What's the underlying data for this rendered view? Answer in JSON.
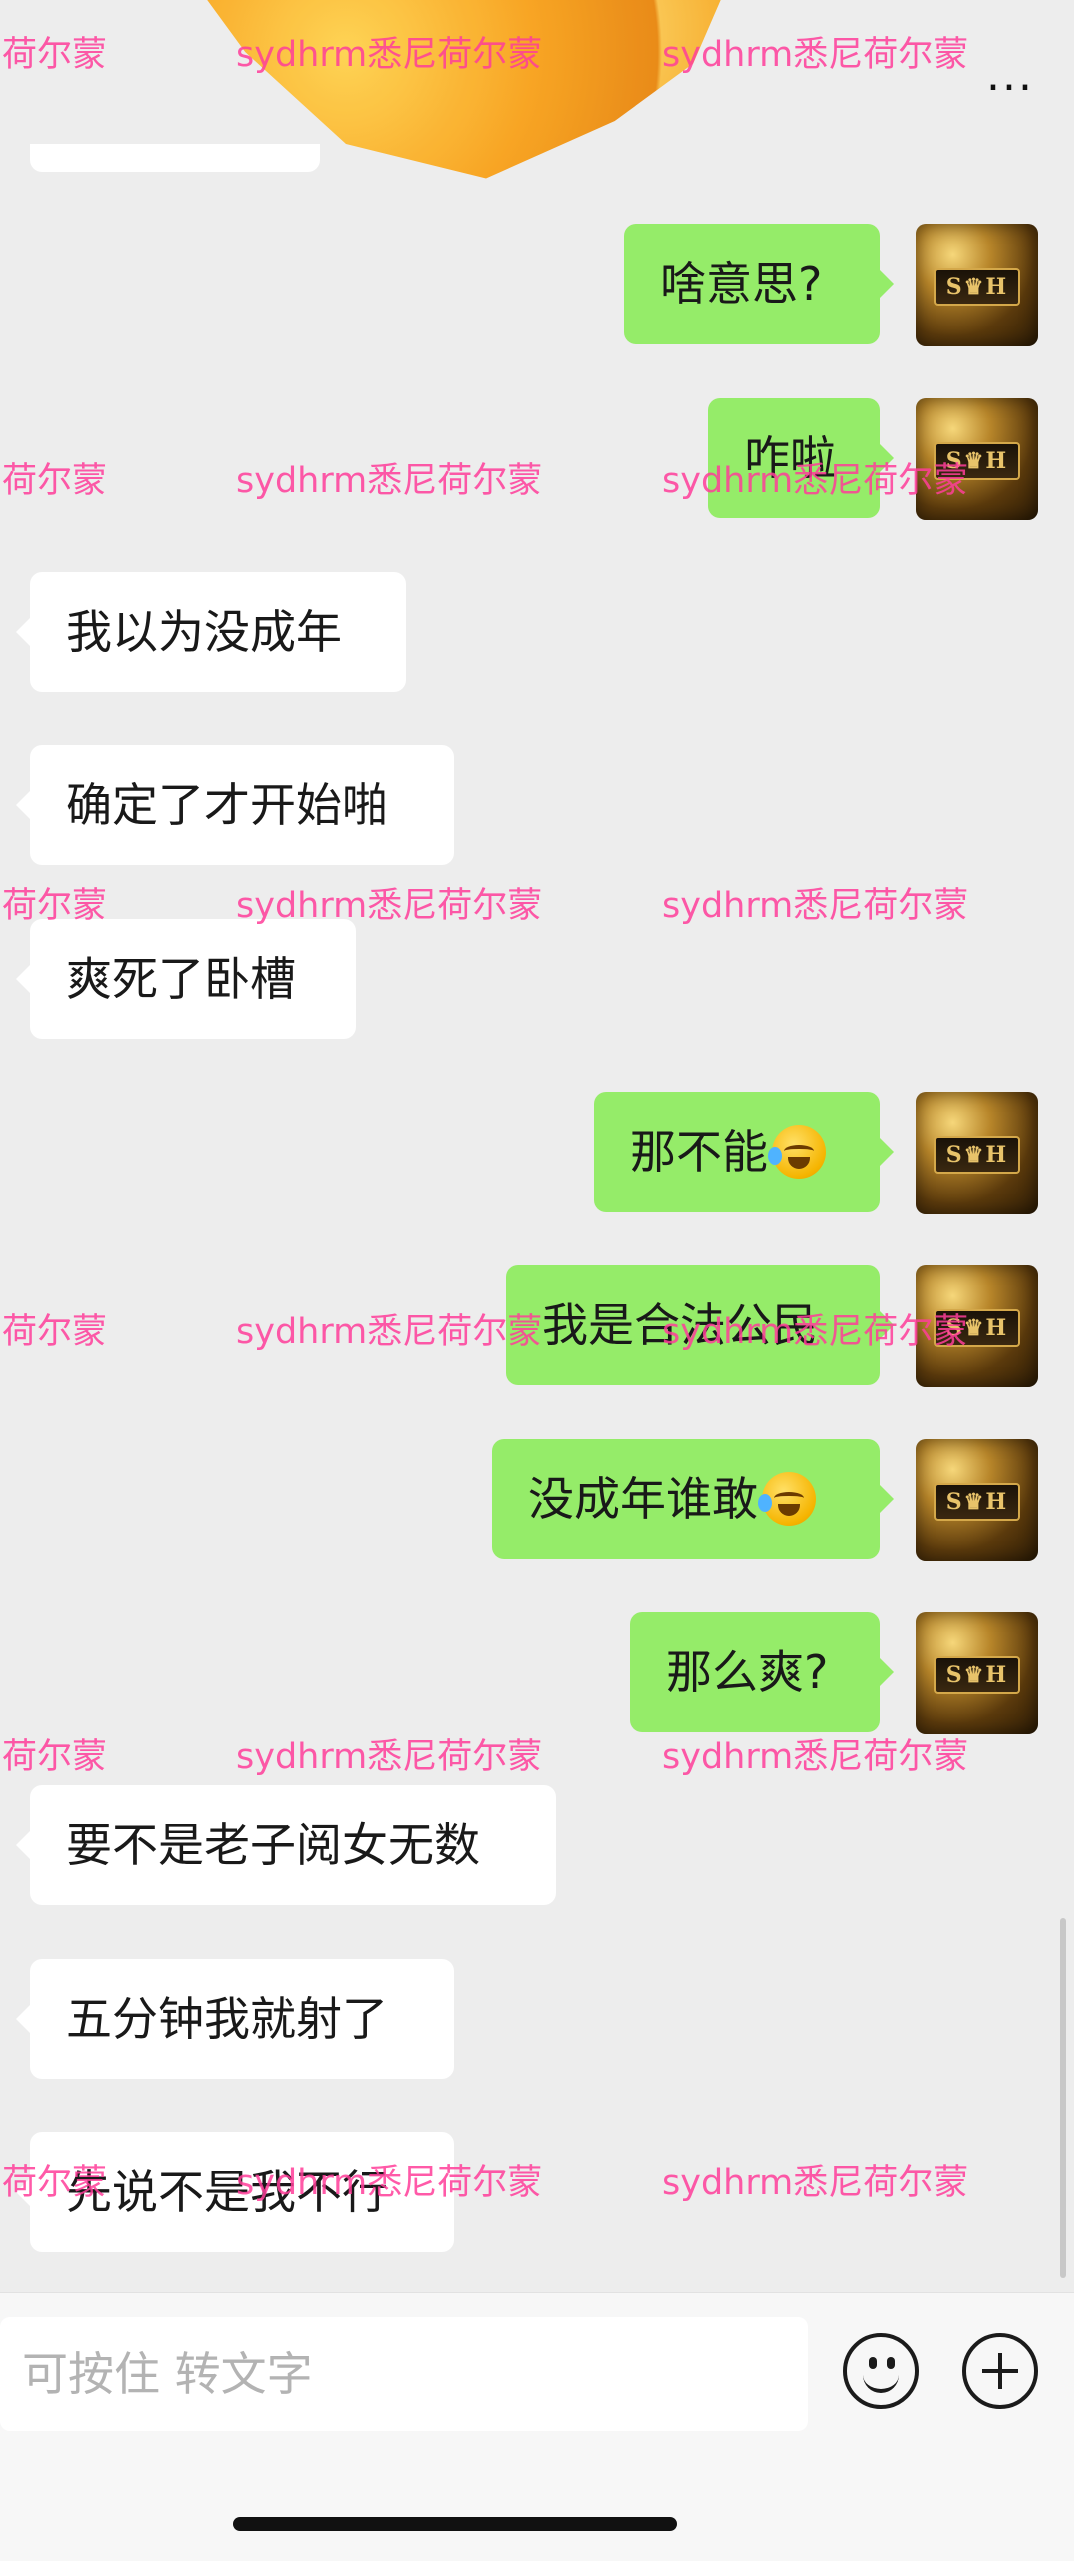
{
  "header": {
    "more_label": "..."
  },
  "watermark": {
    "left_text": "荷尔蒙",
    "right_text": "sydhrm悉尼荷尔蒙"
  },
  "avatar": {
    "plate_text": "S♛H"
  },
  "messages": [
    {
      "side": "out",
      "text": "啥意思?"
    },
    {
      "side": "out",
      "text": "咋啦"
    },
    {
      "side": "in",
      "text": "我以为没成年"
    },
    {
      "side": "in",
      "text": "确定了才开始啪"
    },
    {
      "side": "in",
      "text": "爽死了卧槽"
    },
    {
      "side": "out",
      "text": "那不能",
      "emoji": "crying-laughing"
    },
    {
      "side": "out",
      "text": "我是合法公民"
    },
    {
      "side": "out",
      "text": "没成年谁敢",
      "emoji": "crying-laughing"
    },
    {
      "side": "out",
      "text": "那么爽?"
    },
    {
      "side": "in",
      "text": "要不是老子阅女无数"
    },
    {
      "side": "in",
      "text": "五分钟我就射了"
    },
    {
      "side": "in",
      "text": "先说不是我不行"
    }
  ],
  "input": {
    "placeholder": "可按住 转文字",
    "emoji_button_icon": "smiley-icon",
    "plus_button_icon": "plus-icon"
  },
  "colors": {
    "background": "#ededed",
    "incoming_bubble": "#ffffff",
    "outgoing_bubble": "#95ec69",
    "watermark": "#ff3e9a"
  }
}
